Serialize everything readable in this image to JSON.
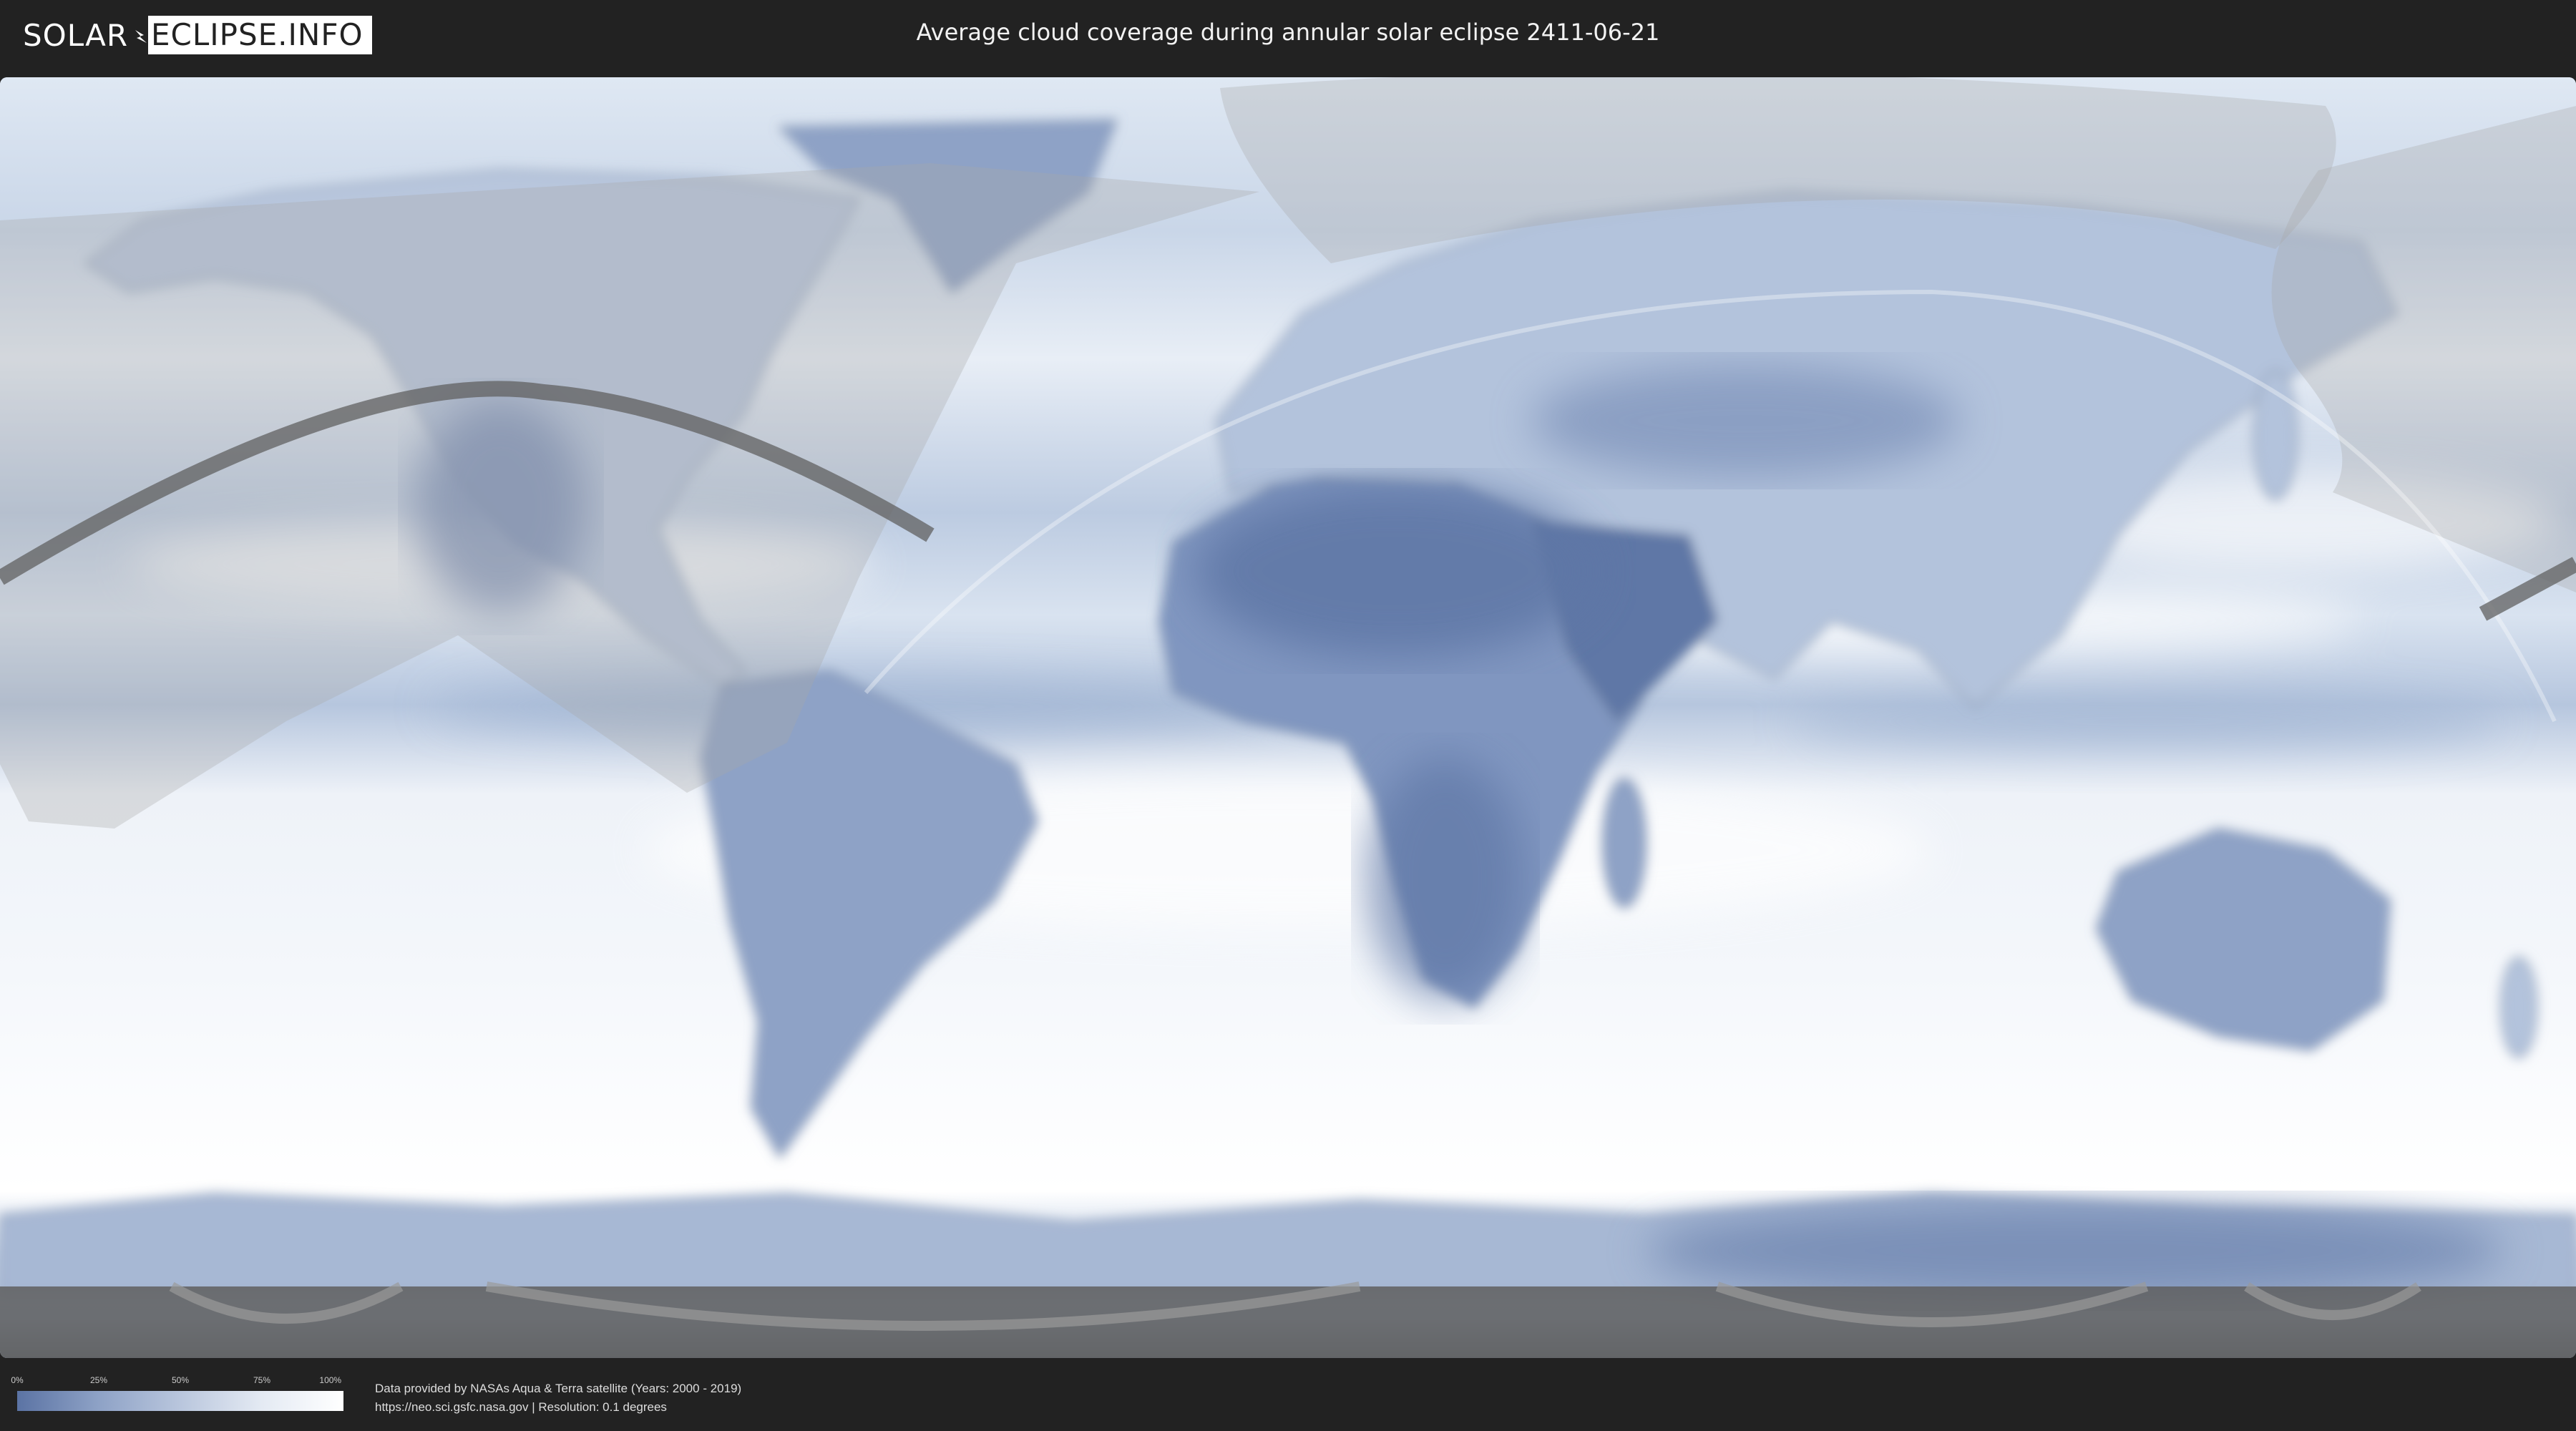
{
  "header": {
    "logo_left": "SOLAR",
    "logo_right": "ECLIPSE.INFO",
    "title": "Average cloud coverage during annular solar eclipse 2411-06-21"
  },
  "legend": {
    "ticks": [
      "0%",
      "25%",
      "50%",
      "75%",
      "100%"
    ],
    "colors": {
      "low": "#5b73a4",
      "high": "#ffffff"
    }
  },
  "footer": {
    "credit_line1": "Data provided by NASAs Aqua & Terra satellite (Years: 2000 - 2019)",
    "credit_line2": "https://neo.sci.gsfc.nasa.gov | Resolution: 0.1 degrees"
  },
  "colors": {
    "background": "#222222",
    "ocean_clear": "#dfe8f3",
    "cloudy": "#ffffff",
    "land_clear": "#5f77a6",
    "eclipse_path": "#555555",
    "night_shade": "#9a9a9a"
  }
}
